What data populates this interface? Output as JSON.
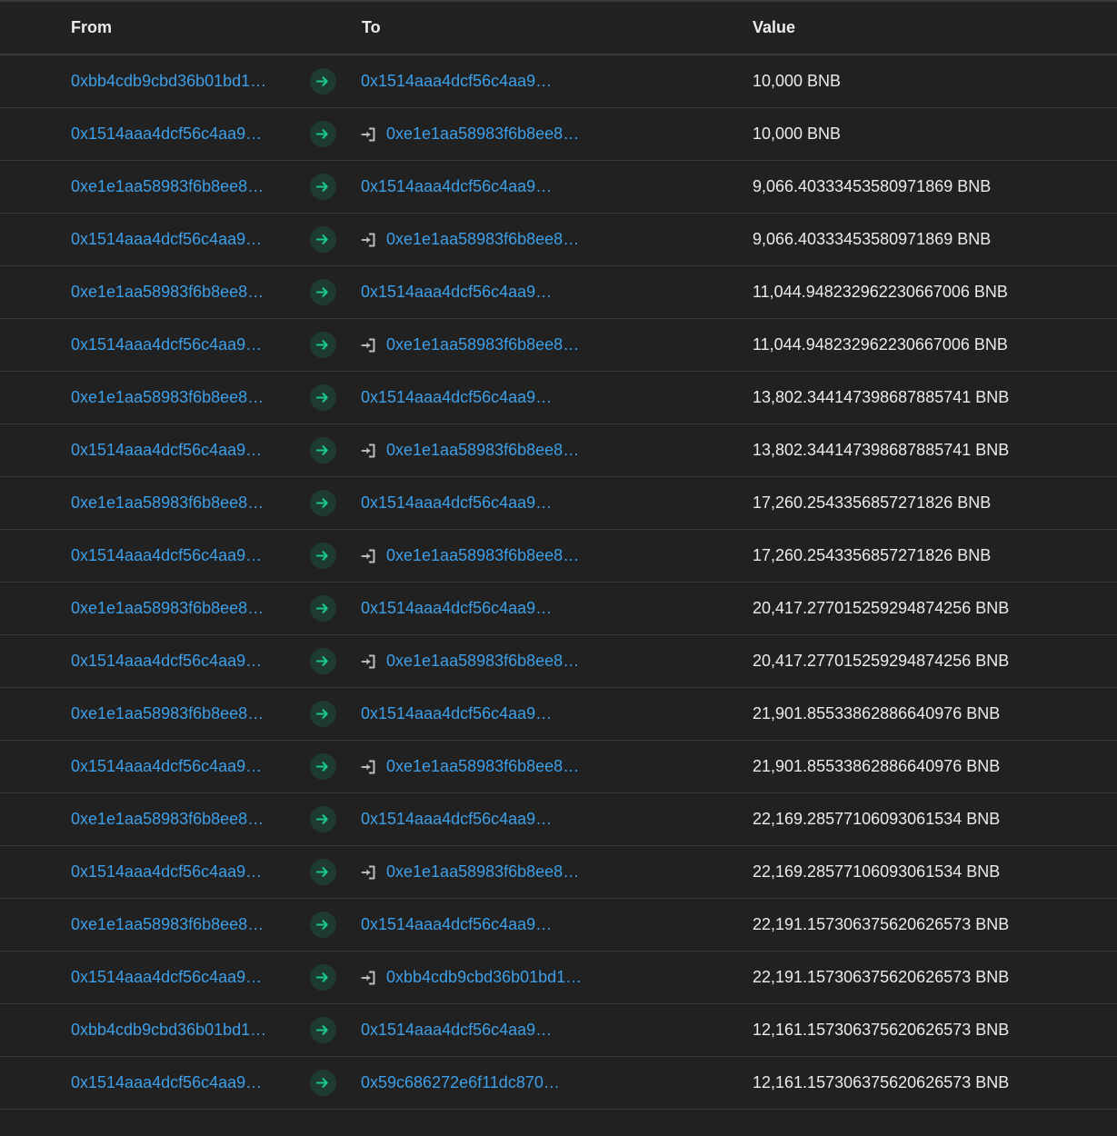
{
  "headers": {
    "from": "From",
    "to": "To",
    "value": "Value"
  },
  "colors": {
    "background": "#212121",
    "link": "#3d9fe8",
    "arrow": "#17c78f",
    "arrow_bg": "#1f3b30",
    "border": "#3a3a3a"
  },
  "rows": [
    {
      "from": "0xbb4cdb9cbd36b01bd1…",
      "to": "0x1514aaa4dcf56c4aa9…",
      "internal": false,
      "value": "10,000 BNB"
    },
    {
      "from": "0x1514aaa4dcf56c4aa9…",
      "to": "0xe1e1aa58983f6b8ee8…",
      "internal": true,
      "value": "10,000 BNB"
    },
    {
      "from": "0xe1e1aa58983f6b8ee8…",
      "to": "0x1514aaa4dcf56c4aa9…",
      "internal": false,
      "value": "9,066.40333453580971869 BNB"
    },
    {
      "from": "0x1514aaa4dcf56c4aa9…",
      "to": "0xe1e1aa58983f6b8ee8…",
      "internal": true,
      "value": "9,066.40333453580971869 BNB"
    },
    {
      "from": "0xe1e1aa58983f6b8ee8…",
      "to": "0x1514aaa4dcf56c4aa9…",
      "internal": false,
      "value": "11,044.948232962230667006 BNB"
    },
    {
      "from": "0x1514aaa4dcf56c4aa9…",
      "to": "0xe1e1aa58983f6b8ee8…",
      "internal": true,
      "value": "11,044.948232962230667006 BNB"
    },
    {
      "from": "0xe1e1aa58983f6b8ee8…",
      "to": "0x1514aaa4dcf56c4aa9…",
      "internal": false,
      "value": "13,802.344147398687885741 BNB"
    },
    {
      "from": "0x1514aaa4dcf56c4aa9…",
      "to": "0xe1e1aa58983f6b8ee8…",
      "internal": true,
      "value": "13,802.344147398687885741 BNB"
    },
    {
      "from": "0xe1e1aa58983f6b8ee8…",
      "to": "0x1514aaa4dcf56c4aa9…",
      "internal": false,
      "value": "17,260.2543356857271826 BNB"
    },
    {
      "from": "0x1514aaa4dcf56c4aa9…",
      "to": "0xe1e1aa58983f6b8ee8…",
      "internal": true,
      "value": "17,260.2543356857271826 BNB"
    },
    {
      "from": "0xe1e1aa58983f6b8ee8…",
      "to": "0x1514aaa4dcf56c4aa9…",
      "internal": false,
      "value": "20,417.277015259294874256 BNB"
    },
    {
      "from": "0x1514aaa4dcf56c4aa9…",
      "to": "0xe1e1aa58983f6b8ee8…",
      "internal": true,
      "value": "20,417.277015259294874256 BNB"
    },
    {
      "from": "0xe1e1aa58983f6b8ee8…",
      "to": "0x1514aaa4dcf56c4aa9…",
      "internal": false,
      "value": "21,901.85533862886640976 BNB"
    },
    {
      "from": "0x1514aaa4dcf56c4aa9…",
      "to": "0xe1e1aa58983f6b8ee8…",
      "internal": true,
      "value": "21,901.85533862886640976 BNB"
    },
    {
      "from": "0xe1e1aa58983f6b8ee8…",
      "to": "0x1514aaa4dcf56c4aa9…",
      "internal": false,
      "value": "22,169.28577106093061534 BNB"
    },
    {
      "from": "0x1514aaa4dcf56c4aa9…",
      "to": "0xe1e1aa58983f6b8ee8…",
      "internal": true,
      "value": "22,169.28577106093061534 BNB"
    },
    {
      "from": "0xe1e1aa58983f6b8ee8…",
      "to": "0x1514aaa4dcf56c4aa9…",
      "internal": false,
      "value": "22,191.157306375620626573 BNB"
    },
    {
      "from": "0x1514aaa4dcf56c4aa9…",
      "to": "0xbb4cdb9cbd36b01bd1…",
      "internal": true,
      "value": "22,191.157306375620626573 BNB"
    },
    {
      "from": "0xbb4cdb9cbd36b01bd1…",
      "to": "0x1514aaa4dcf56c4aa9…",
      "internal": false,
      "value": "12,161.157306375620626573 BNB"
    },
    {
      "from": "0x1514aaa4dcf56c4aa9…",
      "to": "0x59c686272e6f11dc870…",
      "internal": false,
      "value": "12,161.157306375620626573 BNB"
    }
  ]
}
